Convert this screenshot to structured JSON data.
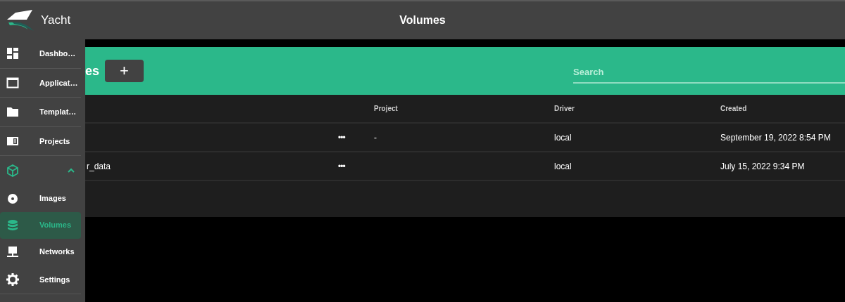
{
  "app": {
    "name": "Yacht"
  },
  "header": {
    "title": "Volumes"
  },
  "sidebar": {
    "items": [
      {
        "kind": "link",
        "label": "Dashbo…",
        "selected": false
      },
      {
        "kind": "link",
        "label": "Applicat…",
        "selected": false
      },
      {
        "kind": "link",
        "label": "Templat…",
        "selected": false
      },
      {
        "kind": "link",
        "label": "Projects",
        "selected": false
      },
      {
        "kind": "group",
        "expanded": true,
        "children": [
          {
            "label": "Images",
            "selected": false
          },
          {
            "label": "Volumes",
            "selected": true
          },
          {
            "label": "Networks",
            "selected": false
          }
        ]
      },
      {
        "kind": "link",
        "label": "Settings",
        "selected": false
      }
    ]
  },
  "card": {
    "title": "es",
    "add_button": "+",
    "search": {
      "placeholder": "Search"
    }
  },
  "table": {
    "columns": [
      "",
      "",
      "Project",
      "Driver",
      "Created"
    ],
    "rows": [
      {
        "name": "",
        "menu": "•••",
        "project": "-",
        "driver": "local",
        "created": "September 19, 2022 8:54 PM"
      },
      {
        "name": "r_data",
        "menu": "•••",
        "project": "",
        "driver": "local",
        "created": "July 15, 2022 9:34 PM"
      }
    ]
  }
}
